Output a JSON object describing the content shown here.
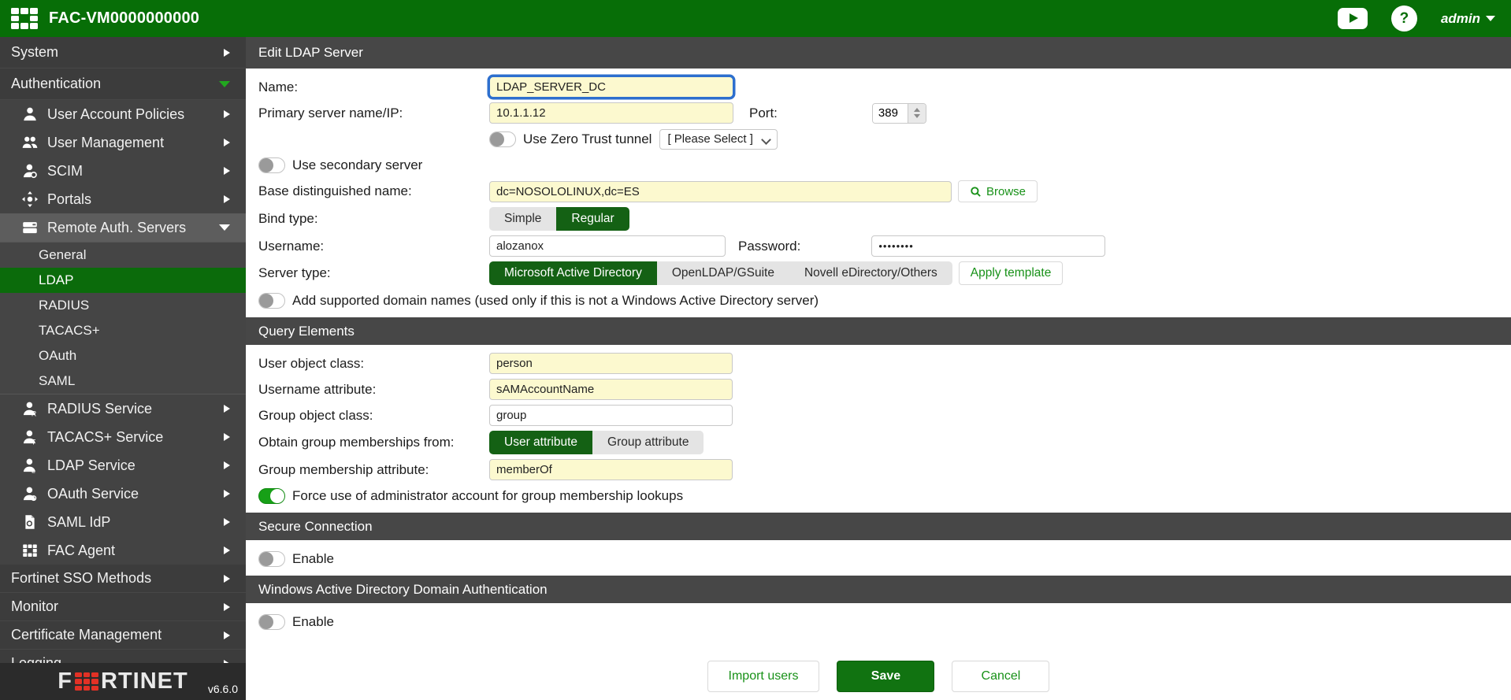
{
  "topbar": {
    "title": "FAC-VM0000000000",
    "admin_label": "admin"
  },
  "sidebar": {
    "system": "System",
    "authentication": "Authentication",
    "auth_children": [
      {
        "label": "User Account Policies",
        "icon": "user-icon"
      },
      {
        "label": "User Management",
        "icon": "users-icon"
      },
      {
        "label": "SCIM",
        "icon": "user-gear-icon"
      },
      {
        "label": "Portals",
        "icon": "portals-icon"
      },
      {
        "label": "Remote Auth. Servers",
        "icon": "servers-icon"
      },
      {
        "label": "RADIUS Service",
        "icon": "user-badge-icon"
      },
      {
        "label": "TACACS+ Service",
        "icon": "user-badge-icon"
      },
      {
        "label": "LDAP Service",
        "icon": "user-badge-icon"
      },
      {
        "label": "OAuth Service",
        "icon": "user-badge-icon"
      },
      {
        "label": "SAML IdP",
        "icon": "document-icon"
      },
      {
        "label": "FAC Agent",
        "icon": "grid-icon"
      }
    ],
    "remote_auth_children": [
      "General",
      "LDAP",
      "RADIUS",
      "TACACS+",
      "OAuth",
      "SAML"
    ],
    "selected_child": "LDAP",
    "bottom_items": [
      "Fortinet SSO Methods",
      "Monitor",
      "Certificate Management",
      "Logging"
    ],
    "logo_left": "F",
    "logo_right": "RTINET",
    "version": "v6.6.0"
  },
  "form": {
    "title": "Edit LDAP Server",
    "name": {
      "label": "Name:",
      "value": "LDAP_SERVER_DC"
    },
    "primary": {
      "label": "Primary server name/IP:",
      "value": "10.1.1.12"
    },
    "port": {
      "label": "Port:",
      "value": "389"
    },
    "zero_trust": {
      "label": "Use Zero Trust tunnel",
      "state": "off",
      "select_value": "[ Please Select ]"
    },
    "secondary": {
      "label": "Use secondary server",
      "state": "off"
    },
    "base_dn": {
      "label": "Base distinguished name:",
      "value": "dc=NOSOLOLINUX,dc=ES",
      "browse_label": "Browse"
    },
    "bind_type": {
      "label": "Bind type:",
      "options": [
        "Simple",
        "Regular"
      ],
      "selected": "Regular"
    },
    "username": {
      "label": "Username:",
      "value": "alozanox"
    },
    "password": {
      "label": "Password:",
      "value": "••••••••"
    },
    "server_type": {
      "label": "Server type:",
      "options": [
        "Microsoft Active Directory",
        "OpenLDAP/GSuite",
        "Novell eDirectory/Others"
      ],
      "selected": "Microsoft Active Directory",
      "apply_label": "Apply template"
    },
    "add_domains": {
      "label": "Add supported domain names (used only if this is not a Windows Active Directory server)",
      "state": "off"
    },
    "sections": {
      "query": "Query Elements",
      "secure": "Secure Connection",
      "winad": "Windows Active Directory Domain Authentication"
    },
    "user_object_class": {
      "label": "User object class:",
      "value": "person"
    },
    "username_attribute": {
      "label": "Username attribute:",
      "value": "sAMAccountName"
    },
    "group_object_class": {
      "label": "Group object class:",
      "value": "group"
    },
    "obtain_memberships": {
      "label": "Obtain group memberships from:",
      "options": [
        "User attribute",
        "Group attribute"
      ],
      "selected": "User attribute"
    },
    "group_membership_attribute": {
      "label": "Group membership attribute:",
      "value": "memberOf"
    },
    "force_admin": {
      "label": "Force use of administrator account for group membership lookups",
      "state": "on"
    },
    "secure_enable": {
      "label": "Enable",
      "state": "off"
    },
    "winad_enable": {
      "label": "Enable",
      "state": "off"
    },
    "buttons": {
      "import": "Import users",
      "save": "Save",
      "cancel": "Cancel"
    }
  },
  "colors": {
    "topbar_green": "#076e07",
    "selected_green": "#0b6b0b",
    "segment_green": "#146114",
    "toggle_green": "#17a017",
    "button_text_green": "#189118",
    "input_yellow": "#fcf9cf",
    "sidebar_gray": "#3c3c3c",
    "section_gray": "#474747",
    "focus_blue": "#2d6fce",
    "logo_red": "#e23125"
  }
}
